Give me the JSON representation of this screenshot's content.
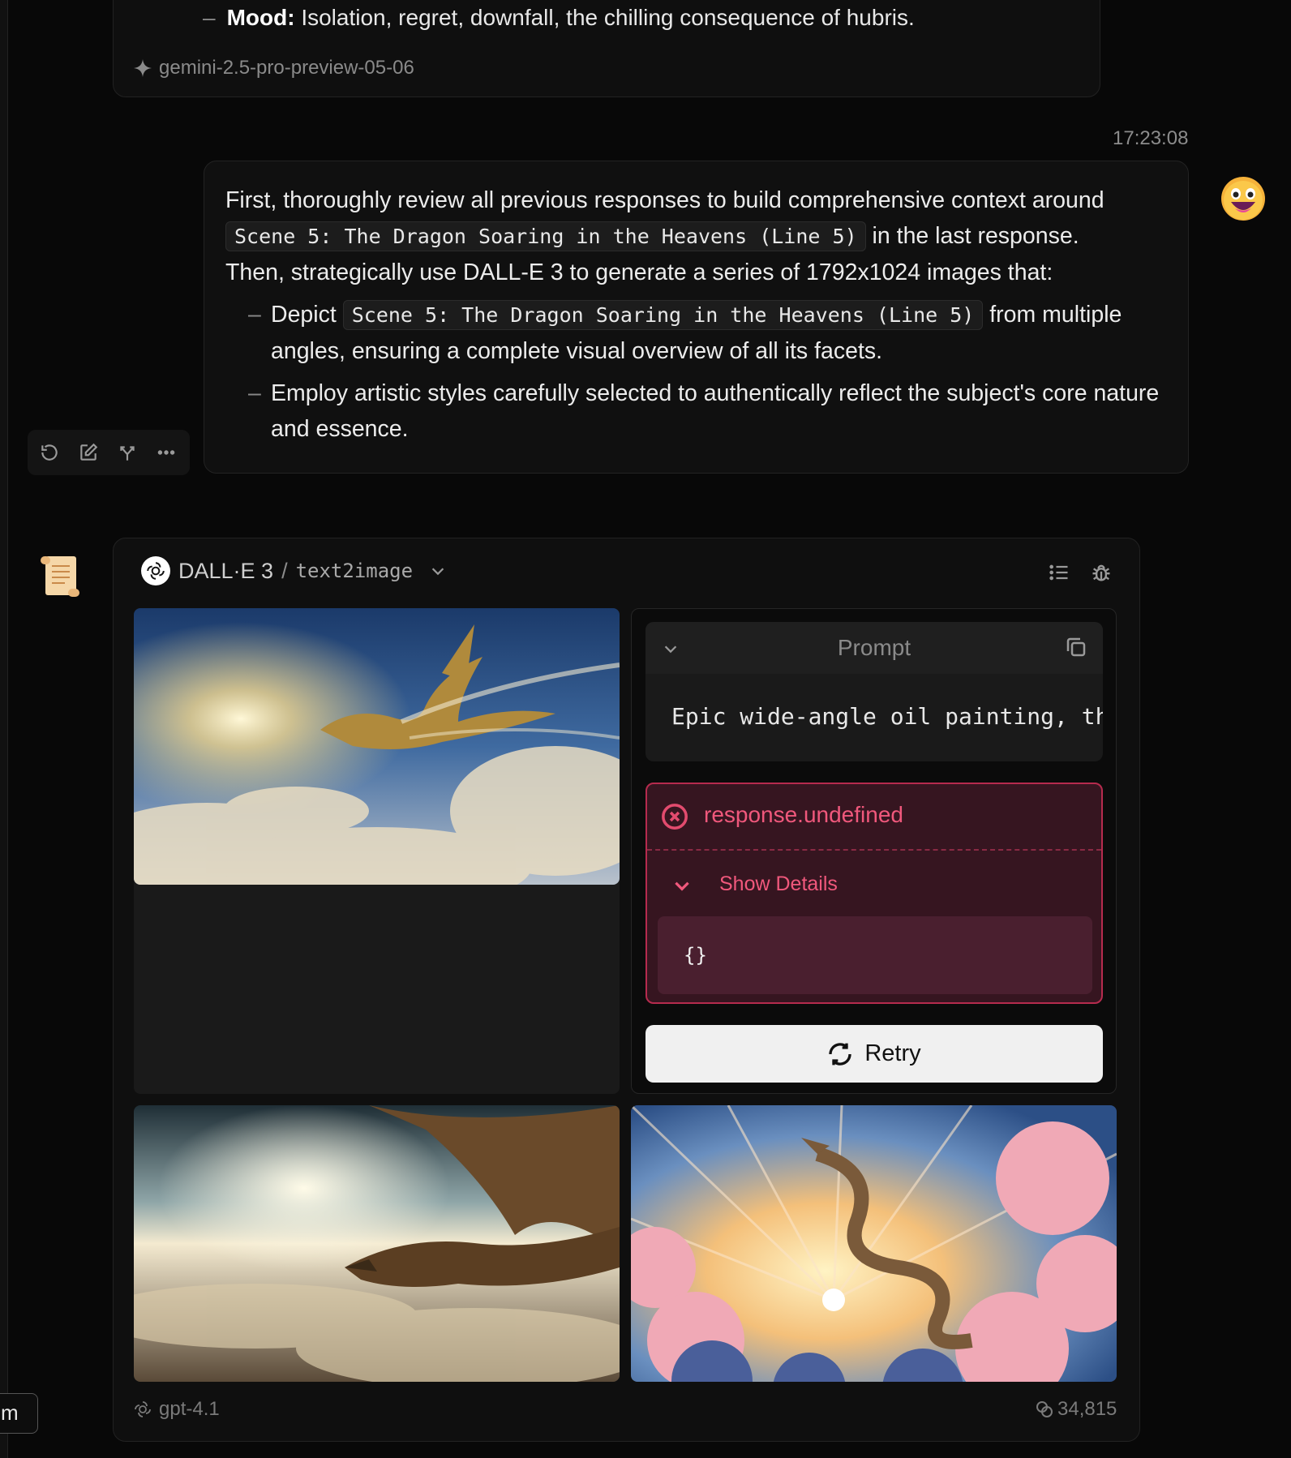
{
  "previous_message": {
    "mood_label": "Mood:",
    "mood_text": "Isolation, regret, downfall, the chilling consequence of hubris.",
    "model": "gemini-2.5-pro-preview-05-06"
  },
  "user_message": {
    "timestamp": "17:23:08",
    "intro_part1": "First, thoroughly review all previous responses to build comprehensive context around",
    "scene_code": "Scene 5: The Dragon Soaring in the Heavens (Line 5)",
    "intro_part2": "in the last response.",
    "intro_part3": "Then, strategically use DALL-E 3 to generate a series of 1792x1024 images that:",
    "bullet1_pre": "Depict",
    "bullet1_code": "Scene 5: The Dragon Soaring in the Heavens (Line 5)",
    "bullet1_post": "from multiple angles, ensuring a complete visual overview of all its facets.",
    "bullet2": "Employ artistic styles carefully selected to authentically reflect the subject's core nature and essence."
  },
  "tool_call": {
    "provider": "DALL·E 3",
    "separator": "/",
    "api": "text2image",
    "prompt_label": "Prompt",
    "prompt_text": "Epic wide-angle oil painting, th",
    "error_title": "response.undefined",
    "show_details": "Show Details",
    "error_body": "{}",
    "retry_label": "Retry"
  },
  "footer": {
    "model": "gpt-4.1",
    "tokens": "34,815"
  },
  "tooltip_fragment": "m",
  "colors": {
    "background": "#080808",
    "error_accent": "#f0587c",
    "error_bg": "#361520",
    "retry_bg": "#f0f0f0"
  }
}
